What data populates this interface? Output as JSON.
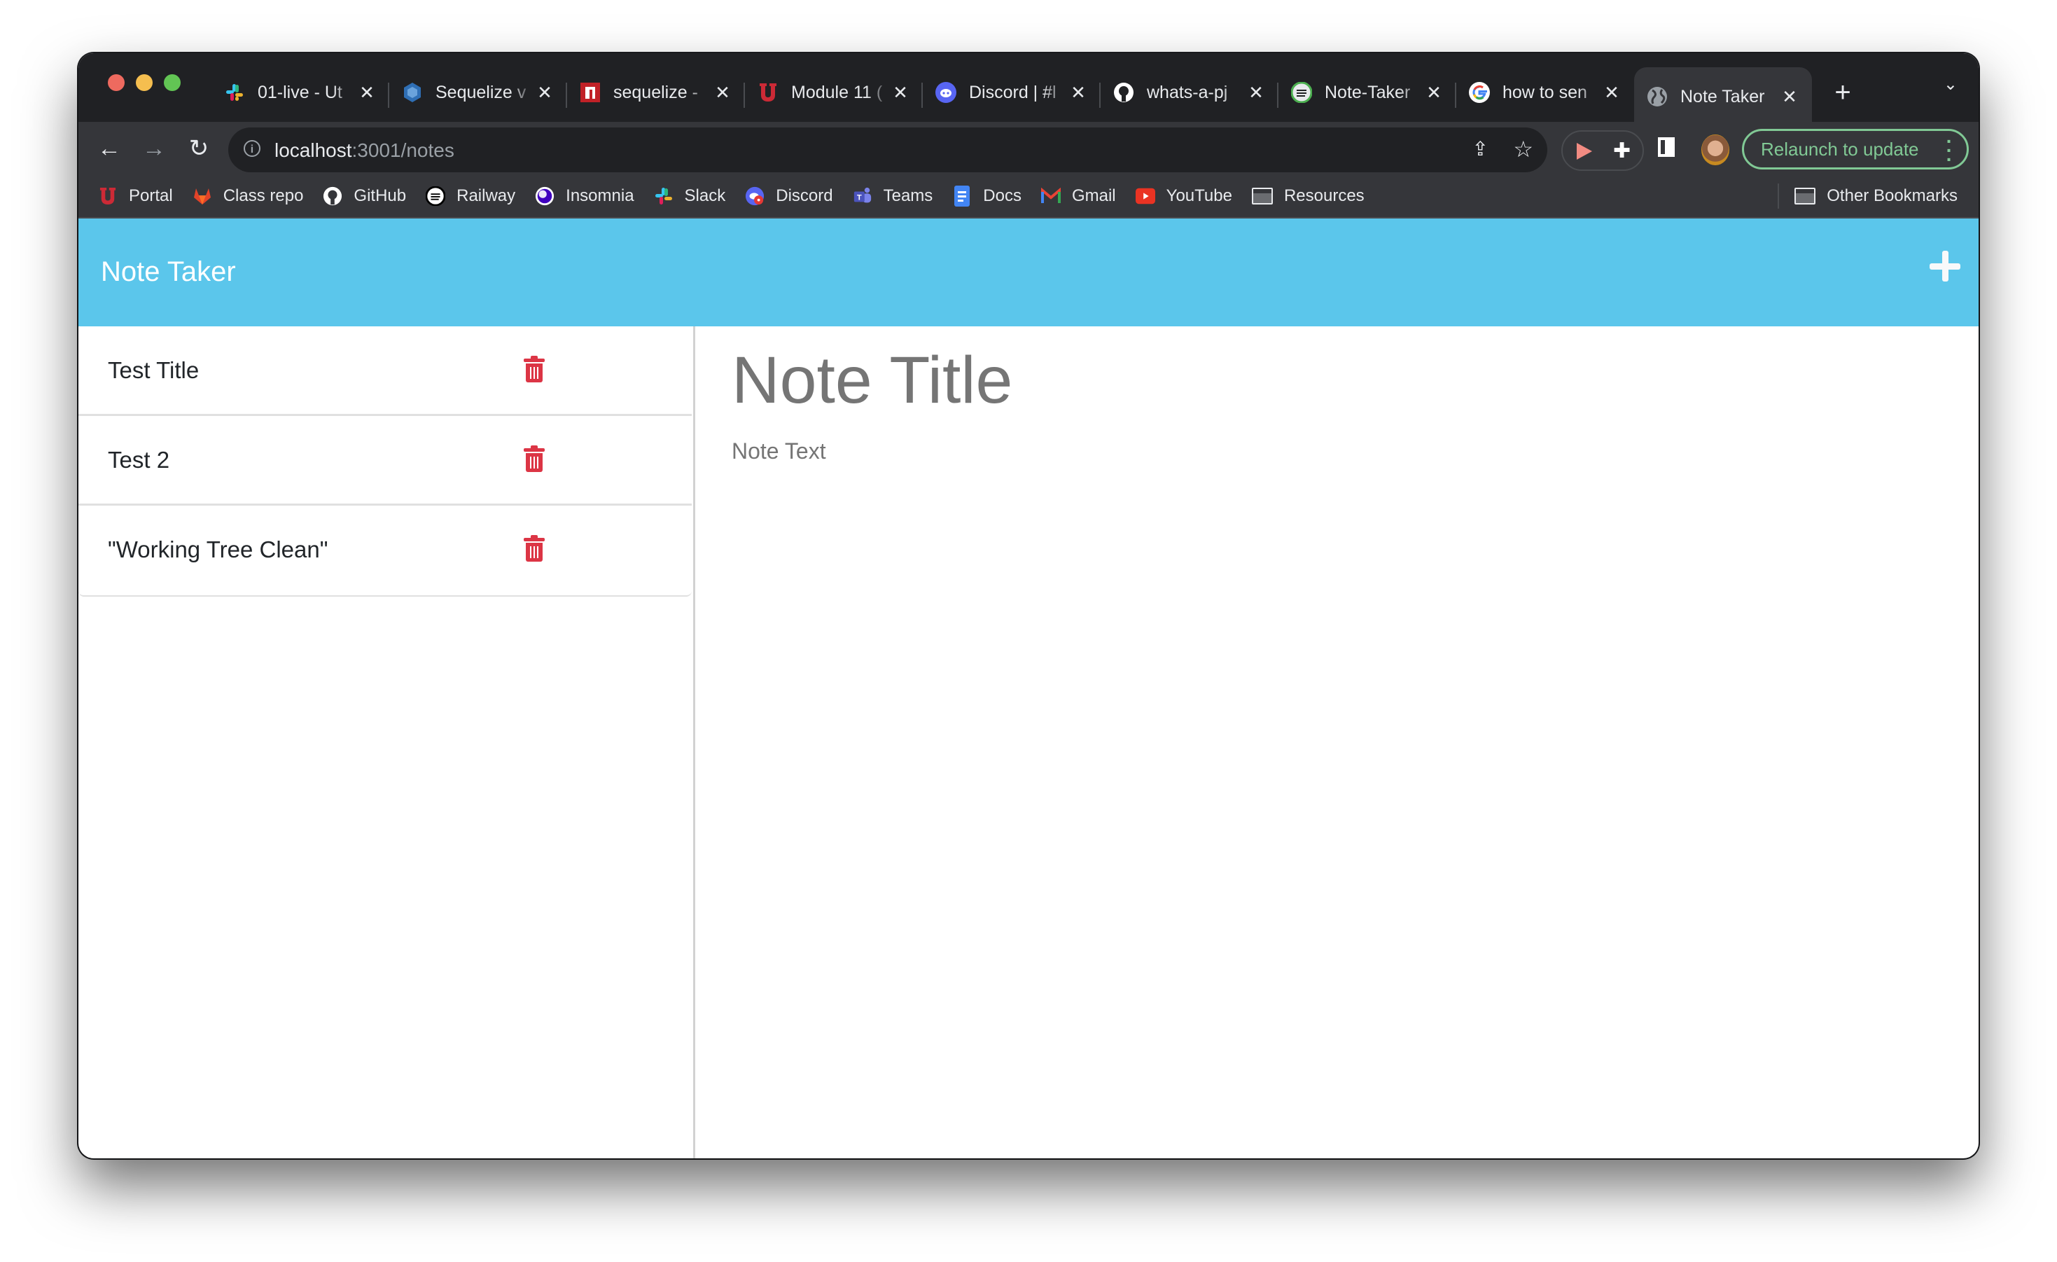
{
  "browser": {
    "tabs": [
      {
        "title": "01-live - Ut",
        "icon": "slack-icon"
      },
      {
        "title": "Sequelize v",
        "icon": "sequelize-icon"
      },
      {
        "title": "sequelize -",
        "icon": "npm-icon"
      },
      {
        "title": "Module 11 (",
        "icon": "utah-u-icon"
      },
      {
        "title": "Discord | #l",
        "icon": "discord-icon"
      },
      {
        "title": "whats-a-pj",
        "icon": "github-icon"
      },
      {
        "title": "Note-Taker",
        "icon": "railway-icon"
      },
      {
        "title": "how to sen",
        "icon": "google-icon"
      },
      {
        "title": "Note Taker",
        "icon": "globe-icon",
        "active": true
      }
    ],
    "new_tab_label": "+",
    "tab_search_label": "⌄",
    "url_host": "localhost",
    "url_rest": ":3001/notes",
    "relaunch_label": "Relaunch to update",
    "bookmarks": [
      {
        "label": "Portal",
        "icon": "utah-u-icon"
      },
      {
        "label": "Class repo",
        "icon": "gitlab-icon"
      },
      {
        "label": "GitHub",
        "icon": "github-icon"
      },
      {
        "label": "Railway",
        "icon": "railway-icon"
      },
      {
        "label": "Insomnia",
        "icon": "insomnia-icon"
      },
      {
        "label": "Slack",
        "icon": "slack-icon"
      },
      {
        "label": "Discord",
        "icon": "discord-icon"
      },
      {
        "label": "Teams",
        "icon": "teams-icon"
      },
      {
        "label": "Docs",
        "icon": "docs-icon"
      },
      {
        "label": "Gmail",
        "icon": "gmail-icon"
      },
      {
        "label": "YouTube",
        "icon": "youtube-icon"
      },
      {
        "label": "Resources",
        "icon": "folder-icon"
      }
    ],
    "other_bookmarks_label": "Other Bookmarks"
  },
  "app": {
    "title": "Note Taker",
    "header_color": "#5bc6eb",
    "add_note_icon": "plus-icon",
    "notes": [
      {
        "title": "Test Title"
      },
      {
        "title": "Test 2"
      },
      {
        "title": "\"Working Tree Clean\""
      }
    ],
    "delete_color": "#dc3545",
    "editor": {
      "title_placeholder": "Note Title",
      "text_placeholder": "Note Text"
    }
  }
}
